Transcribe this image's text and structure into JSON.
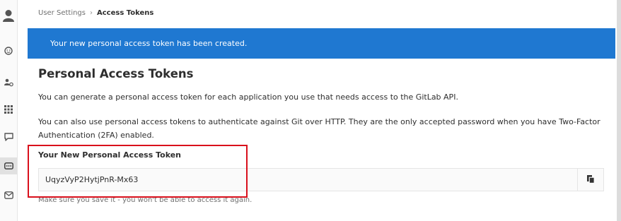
{
  "sidebar": {
    "items": [
      {
        "icon": "user-icon"
      },
      {
        "icon": "smile-icon"
      },
      {
        "icon": "user-gear-icon"
      },
      {
        "icon": "grid-apps-icon"
      },
      {
        "icon": "comment-icon"
      },
      {
        "icon": "access-token-icon",
        "active": true
      },
      {
        "icon": "mail-icon"
      }
    ]
  },
  "breadcrumb": {
    "parent": "User Settings",
    "separator": "›",
    "current": "Access Tokens"
  },
  "flash": {
    "message": "Your new personal access token has been created.",
    "color": "#1f78d1"
  },
  "main": {
    "title": "Personal Access Tokens",
    "description_1": "You can generate a personal access token for each application you use that needs access to the GitLab API.",
    "description_2": "You can also use personal access tokens to authenticate against Git over HTTP. They are the only accepted password when you have Two-Factor Authentication (2FA) enabled.",
    "new_token": {
      "label": "Your New Personal Access Token",
      "value": "UqyzVyP2HytjPnR-Mx63",
      "copy_icon": "copy-clipboard-icon",
      "hint": "Make sure you save it - you won't be able to access it again."
    }
  },
  "colors": {
    "highlight_box": "#d9101c",
    "brand_blue": "#1f78d1"
  }
}
